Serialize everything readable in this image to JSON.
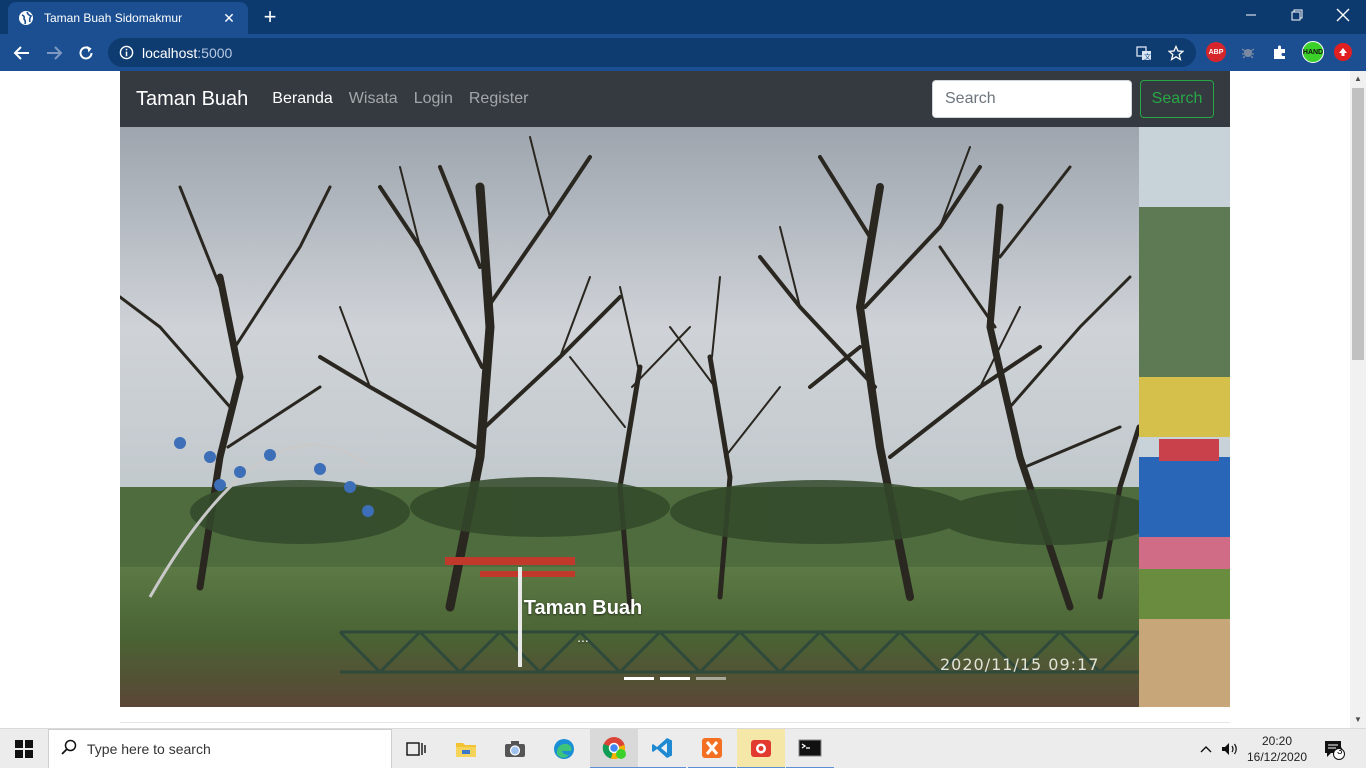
{
  "browser": {
    "tab_title": "Taman Buah Sidomakmur",
    "url_host": "localhost",
    "url_port": ":5000",
    "extensions": {
      "adblock_label": "ABP",
      "profile_label": "HAND"
    }
  },
  "navbar": {
    "brand": "Taman Buah",
    "links": [
      {
        "label": "Beranda",
        "active": true
      },
      {
        "label": "Wisata",
        "active": false
      },
      {
        "label": "Login",
        "active": false
      },
      {
        "label": "Register",
        "active": false
      }
    ],
    "search_placeholder": "Search",
    "search_button": "Search",
    "bg_color": "#343a40",
    "success_color": "#28a745"
  },
  "carousel": {
    "caption_title": "Taman Buah",
    "caption_text": "...",
    "photo_timestamp": "2020/11/15 09:17",
    "indicator_count": 3,
    "active_index": 0
  },
  "taskbar": {
    "search_placeholder": "Type here to search",
    "time": "20:20",
    "date": "16/12/2020",
    "notification_count": "3",
    "apps": [
      "task-view",
      "file-explorer",
      "camera",
      "edge",
      "chrome",
      "vscode",
      "xampp",
      "screenshot-tool",
      "terminal"
    ]
  }
}
